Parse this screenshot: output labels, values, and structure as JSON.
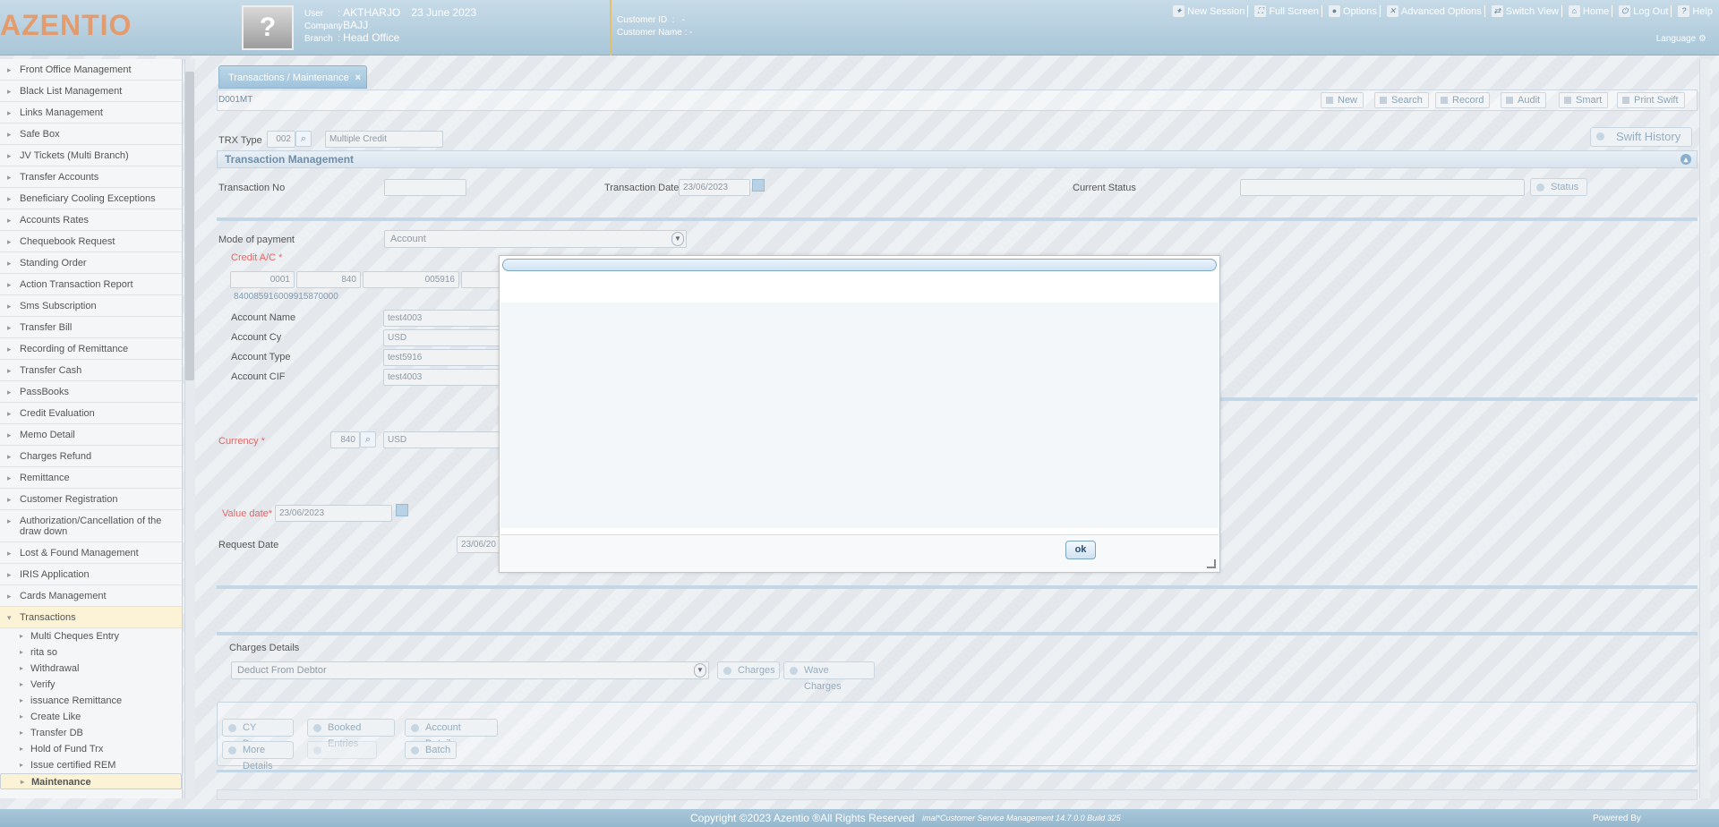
{
  "header": {
    "logo": "AZENTIO",
    "avatar_glyph": "?",
    "user_key": "User",
    "user_value": "AKTHARJO",
    "date": "23 June 2023",
    "company_key": "Company",
    "company_value": "BAJJ",
    "branch_key": "Branch",
    "branch_value": "Head Office",
    "customer_id_label": "Customer ID",
    "customer_id_value": "-",
    "customer_name_label": "Customer Name",
    "customer_name_value": "-",
    "nav": [
      "New Session",
      "Full Screen",
      "Options",
      "Advanced Options",
      "Switch View",
      "Home",
      "Log Out",
      "Help"
    ],
    "language": "Language"
  },
  "sidebar": {
    "items": [
      "Front Office Management",
      "Black List Management",
      "Links Management",
      "Safe Box",
      "JV Tickets (Multi Branch)",
      "Transfer Accounts",
      "Beneficiary Cooling Exceptions",
      "Accounts Rates",
      "Chequebook Request",
      "Standing Order",
      "Action Transaction Report",
      "Sms Subscription",
      "Transfer Bill",
      "Recording of Remittance",
      "Transfer Cash",
      "PassBooks",
      "Credit Evaluation",
      "Memo Detail",
      "Charges Refund",
      "Remittance",
      "Customer Registration",
      "Authorization/Cancellation of the draw down",
      "Lost & Found Management",
      "IRIS Application",
      "Cards Management",
      "Transactions"
    ],
    "sub_items": [
      "Multi Cheques Entry",
      "rita so",
      "Withdrawal",
      "Verify",
      "issuance Remittance",
      "Create Like",
      "Transfer DB",
      "Hold of Fund Trx",
      "Issue certified REM",
      "Maintenance"
    ]
  },
  "main": {
    "tab_label": "Transactions / Maintenance",
    "tab_close": "×",
    "screen_code": "D001MT",
    "toolbar": [
      "New",
      "Search",
      "Record",
      "Audit",
      "Smart",
      "Print Swift"
    ],
    "trx_type_label": "TRX Type",
    "trx_type_code": "002",
    "trx_type_desc": "Multiple Credit",
    "swift_history": "Swift History",
    "section_title": "Transaction Management",
    "transaction_no_label": "Transaction No",
    "transaction_date_label": "Transaction Date",
    "transaction_date": "23/06/2023",
    "current_status_label": "Current Status",
    "status_button": "Status",
    "mode_of_payment_label": "Mode of payment",
    "mode_of_payment": "Account",
    "credit_ac_label": "Credit A/C *",
    "ac_parts": [
      "0001",
      "840",
      "005916",
      ""
    ],
    "iban": "840085916009915870000",
    "account_name_label": "Account Name",
    "account_name": "test4003",
    "account_cy_label": "Account Cy",
    "account_cy": "USD",
    "account_type_label": "Account Type",
    "account_type": "test5916",
    "account_cif_label": "Account CIF",
    "account_cif": "test4003",
    "currency_label": "Currency *",
    "currency_code": "840",
    "currency_name": "USD",
    "value_date_label": "Value date*",
    "value_date": "23/06/2023",
    "request_date_label": "Request Date",
    "request_date": "23/06/20",
    "charges_details_label": "Charges Details",
    "charges_option": "Deduct From Debtor",
    "charges_button": "Charges",
    "waive_charges_button": "Wave Charges",
    "bottom_buttons_row1": [
      "CY Denom.",
      "Booked Entries",
      "Account Details"
    ],
    "bottom_buttons_row2": [
      "More Details",
      "",
      "Batch"
    ]
  },
  "modal": {
    "ok_label": "ok"
  },
  "footer": {
    "copyright": "Copyright ©2023 Azentio ®All Rights Reserved",
    "product": "imal*Customer Service Management 14.7.0.0 Build 325",
    "powered": "Powered By"
  },
  "colors": {
    "header": "#a9c6d8",
    "accent": "#f08a4a",
    "required": "#e06666",
    "section": "#6f8ea8"
  }
}
